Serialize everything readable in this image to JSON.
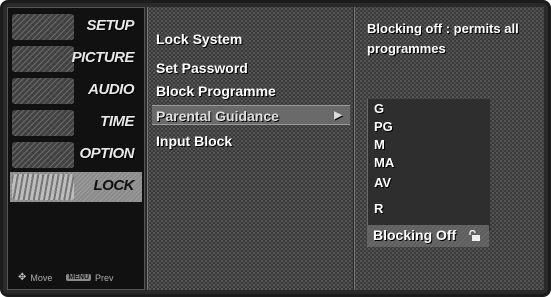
{
  "left_menu": {
    "items": [
      {
        "label": "SETUP",
        "icon": "setup-icon"
      },
      {
        "label": "PICTURE",
        "icon": "picture-icon"
      },
      {
        "label": "AUDIO",
        "icon": "audio-icon"
      },
      {
        "label": "TIME",
        "icon": "time-icon"
      },
      {
        "label": "OPTION",
        "icon": "option-icon"
      },
      {
        "label": "LOCK",
        "icon": "lock-menu-icon",
        "active": true
      }
    ],
    "footer": {
      "move_label": "Move",
      "menu_key": "MENU",
      "prev_label": "Prev"
    }
  },
  "submenu": {
    "items": [
      {
        "label": "Lock System"
      },
      {
        "label": "Set Password"
      },
      {
        "label": "Block Programme"
      },
      {
        "label": "Parental Guidance",
        "selected": true
      },
      {
        "label": "Input Block"
      }
    ]
  },
  "right_panel": {
    "description": "Blocking off : permits all programmes",
    "ratings": [
      "G",
      "PG",
      "M",
      "MA",
      "AV",
      "R"
    ],
    "blocking_option": "Blocking Off"
  }
}
